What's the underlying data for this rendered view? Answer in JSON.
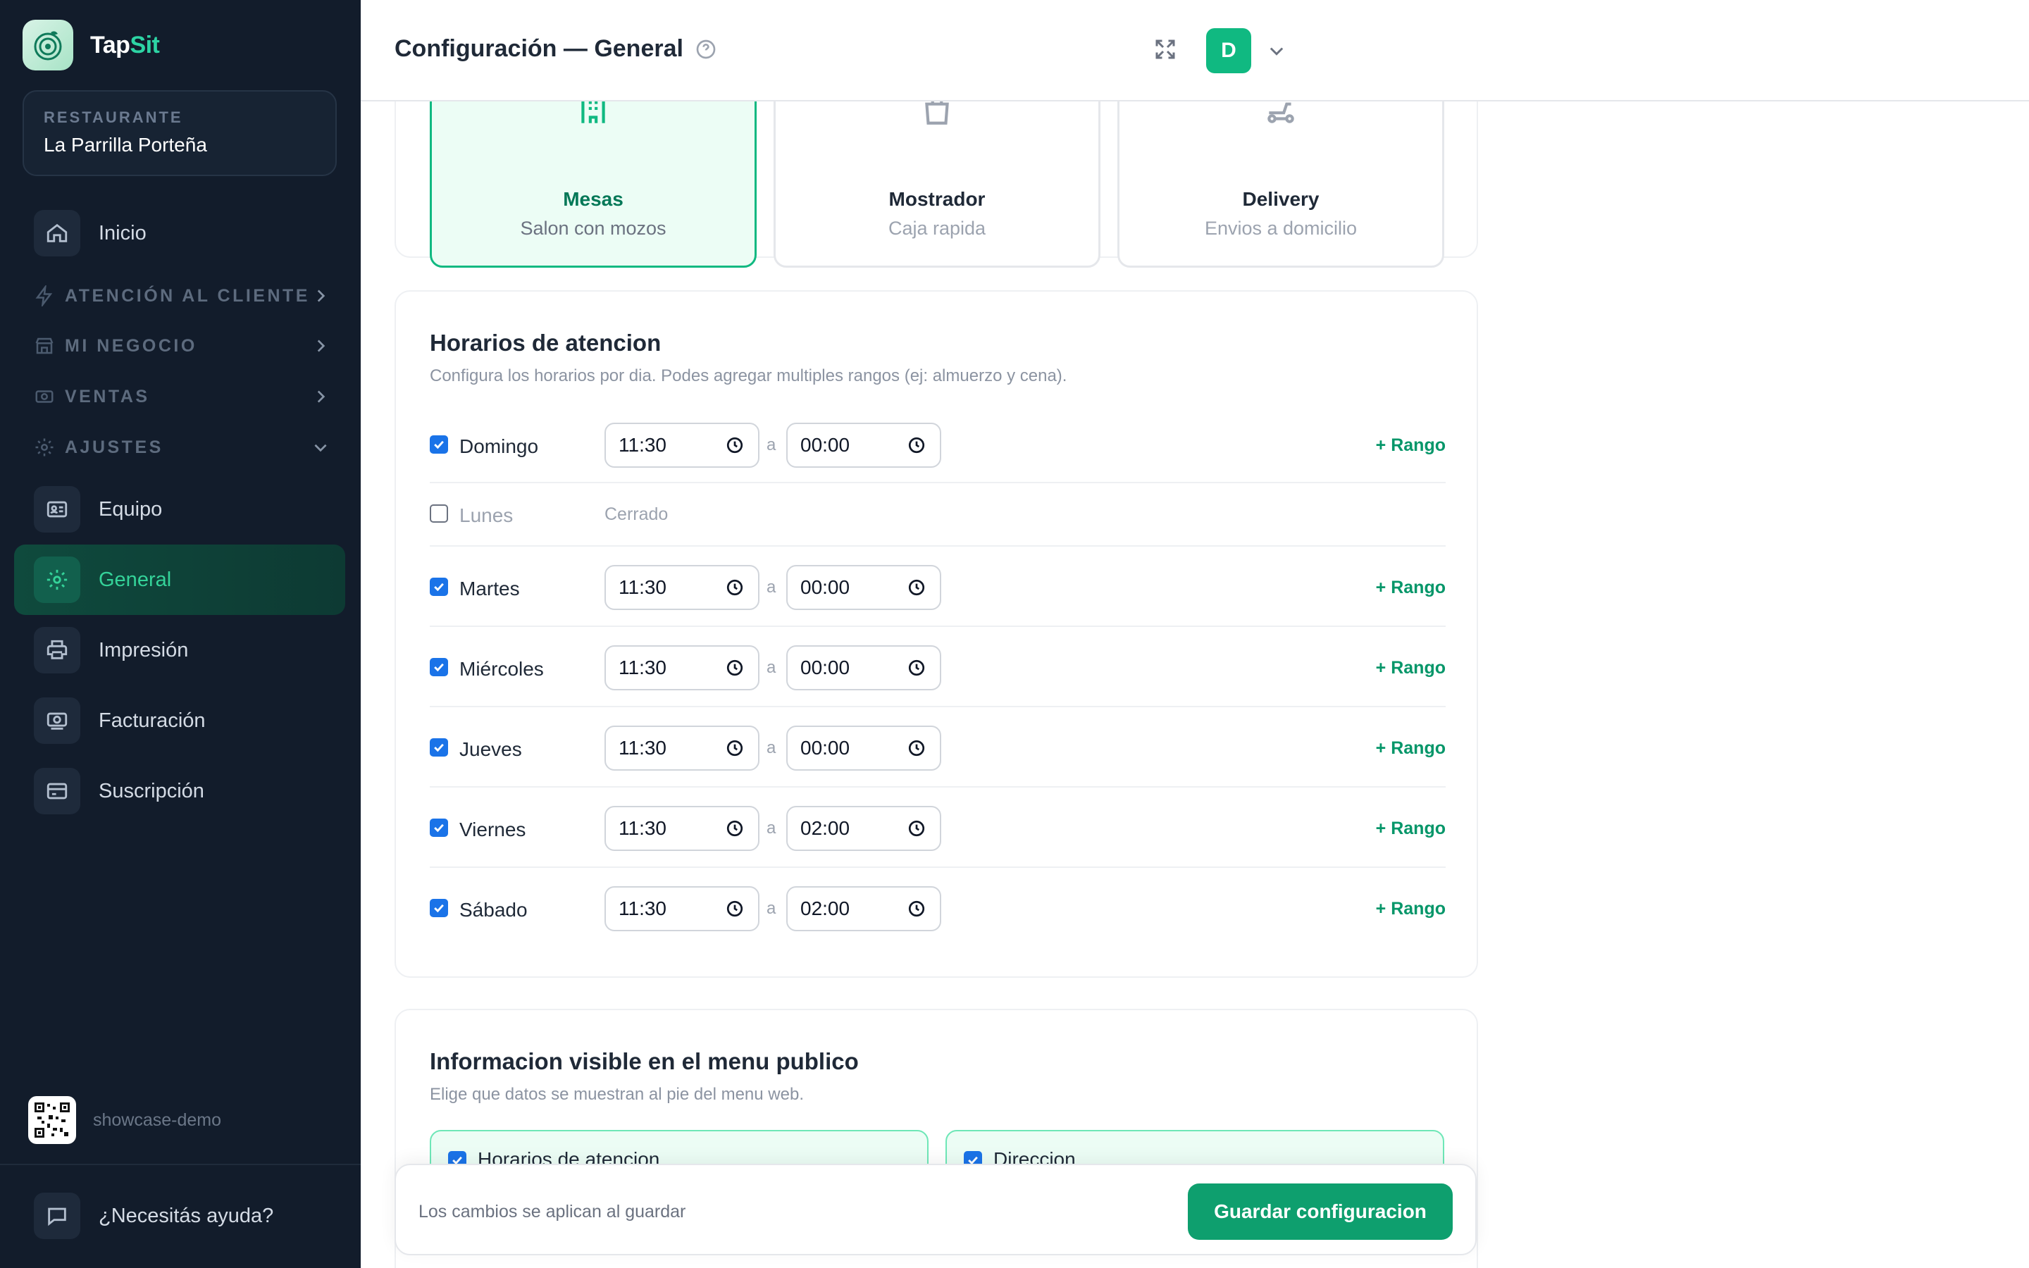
{
  "app": {
    "name_a": "Tap",
    "name_b": "Sit"
  },
  "restaurant": {
    "label": "RESTAURANTE",
    "name": "La Parrilla Porteña"
  },
  "nav": {
    "inicio": "Inicio",
    "atencion": "ATENCIÓN AL CLIENTE",
    "negocio": "MI NEGOCIO",
    "ventas": "VENTAS",
    "ajustes": "AJUSTES",
    "equipo": "Equipo",
    "general": "General",
    "impresion": "Impresión",
    "facturacion": "Facturación",
    "suscripcion": "Suscripción"
  },
  "footer": {
    "account": "showcase-demo",
    "help": "¿Necesitás ayuda?"
  },
  "header": {
    "title": "Configuración — General",
    "avatar": "D"
  },
  "modes": [
    {
      "title": "Mesas",
      "subtitle": "Salon con mozos",
      "selected": true
    },
    {
      "title": "Mostrador",
      "subtitle": "Caja rapida",
      "selected": false
    },
    {
      "title": "Delivery",
      "subtitle": "Envios a domicilio",
      "selected": false
    }
  ],
  "horarios": {
    "title": "Horarios de atencion",
    "subtitle": "Configura los horarios por dia. Podes agregar multiples rangos (ej: almuerzo y cena).",
    "separator": "a",
    "add_range": "+ Rango",
    "closed": "Cerrado",
    "days": [
      {
        "name": "Domingo",
        "enabled": true,
        "from": "11:30",
        "to": "00:00"
      },
      {
        "name": "Lunes",
        "enabled": false
      },
      {
        "name": "Martes",
        "enabled": true,
        "from": "11:30",
        "to": "00:00"
      },
      {
        "name": "Miércoles",
        "enabled": true,
        "from": "11:30",
        "to": "00:00"
      },
      {
        "name": "Jueves",
        "enabled": true,
        "from": "11:30",
        "to": "00:00"
      },
      {
        "name": "Viernes",
        "enabled": true,
        "from": "11:30",
        "to": "02:00"
      },
      {
        "name": "Sábado",
        "enabled": true,
        "from": "11:30",
        "to": "02:00"
      }
    ]
  },
  "menu_info": {
    "title": "Informacion visible en el menu publico",
    "subtitle": "Elige que datos se muestran al pie del menu web.",
    "options": [
      {
        "label": "Horarios de atencion",
        "checked": true
      },
      {
        "label": "Direccion",
        "checked": true
      }
    ]
  },
  "savebar": {
    "hint": "Los cambios se aplican al guardar",
    "button": "Guardar configuracion"
  },
  "colors": {
    "accent": "#10b981",
    "sidebar": "#121c2b",
    "checkbox": "#1a73e8"
  }
}
